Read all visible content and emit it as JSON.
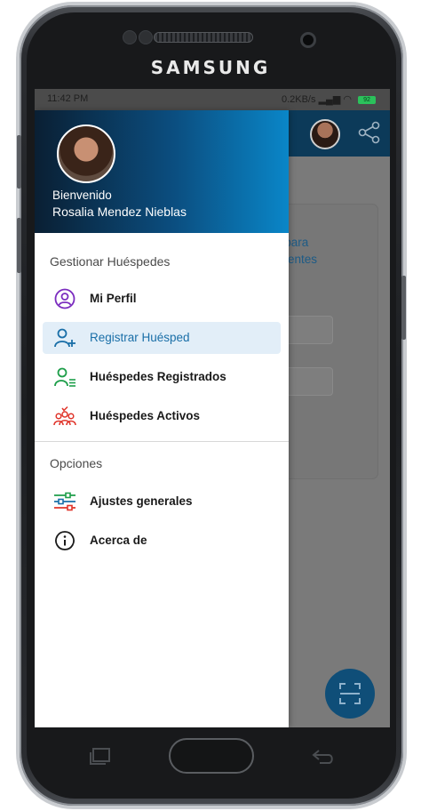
{
  "device": {
    "brand": "SAMSUNG"
  },
  "statusbar": {
    "time": "11:42 PM",
    "signal_info": "0.2KB/s",
    "battery": "92"
  },
  "drawer": {
    "welcome": "Bienvenido",
    "user_name": "Rosalia Mendez Nieblas",
    "section1": "Gestionar Huéspedes",
    "items1": [
      {
        "label": "Mi Perfil",
        "icon": "profile-icon"
      },
      {
        "label": "Registrar Huésped",
        "icon": "add-user-icon"
      },
      {
        "label": "Huéspedes Registrados",
        "icon": "user-list-icon"
      },
      {
        "label": "Huéspedes Activos",
        "icon": "group-icon"
      }
    ],
    "section2": "Opciones",
    "items2": [
      {
        "label": "Ajustes generales",
        "icon": "sliders-icon"
      },
      {
        "label": "Acerca de",
        "icon": "info-icon"
      }
    ]
  },
  "background": {
    "text_line1": "a para",
    "text_line2": "anentes"
  },
  "colors": {
    "accent": "#1a6fa8",
    "header_start": "#0a1f33",
    "header_end": "#0a86c8",
    "active_bg": "#e2eef8"
  }
}
